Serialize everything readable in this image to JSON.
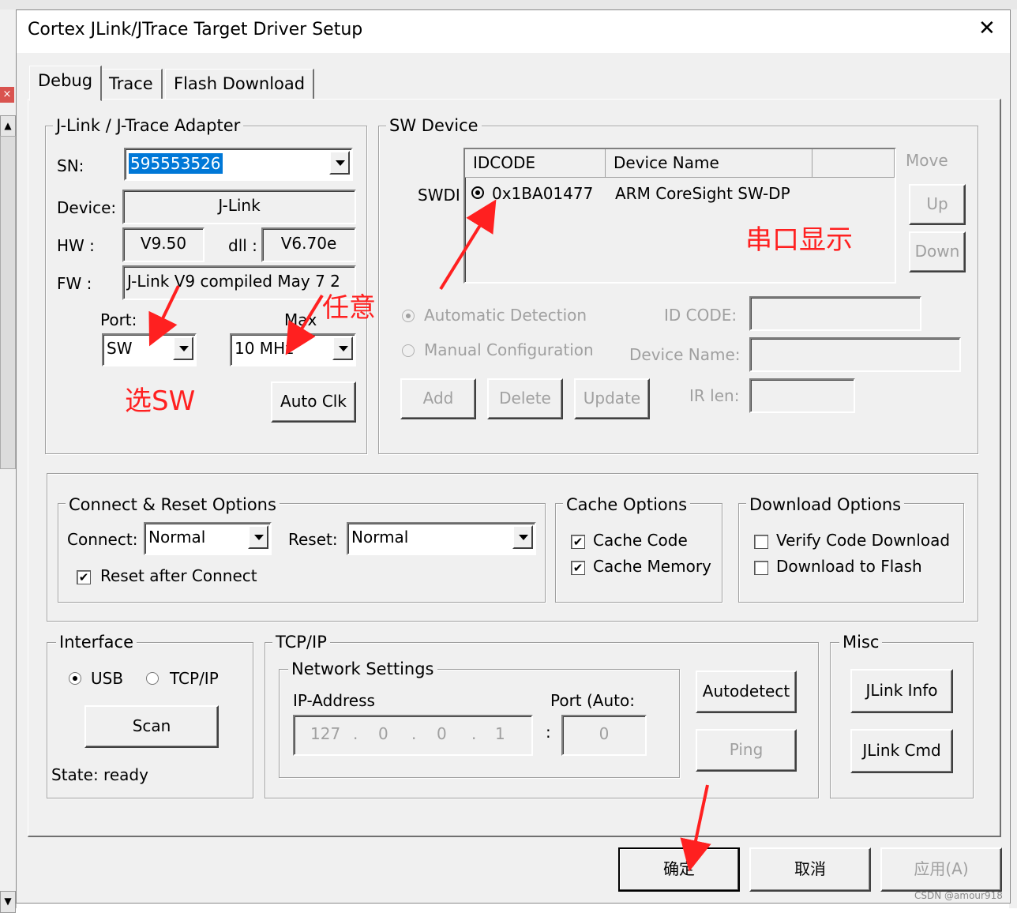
{
  "window": {
    "title": "Cortex JLink/JTrace Target Driver Setup"
  },
  "tabs": [
    {
      "label": "Debug"
    },
    {
      "label": "Trace"
    },
    {
      "label": "Flash Download"
    }
  ],
  "adapter": {
    "group_label": "J-Link / J-Trace Adapter",
    "sn_label": "SN:",
    "sn_value": "595553526",
    "device_label": "Device:",
    "device_value": "J-Link",
    "hw_label": "HW :",
    "hw_value": "V9.50",
    "dll_label": "dll :",
    "dll_value": "V6.70e",
    "fw_label": "FW :",
    "fw_value": "J-Link V9 compiled May  7 2",
    "port_label": "Port:",
    "port_value": "SW",
    "max_label": "Max",
    "max_value": "10 MHz",
    "autoclk_label": "Auto Clk"
  },
  "sw_device": {
    "group_label": "SW Device",
    "row_label": "SWDI",
    "columns": [
      "IDCODE",
      "Device Name"
    ],
    "rows": [
      {
        "idcode": "0x1BA01477",
        "name": "ARM CoreSight SW-DP"
      }
    ],
    "move_label": "Move",
    "up_label": "Up",
    "down_label": "Down",
    "auto_label": "Automatic Detection",
    "manual_label": "Manual Configuration",
    "idcode_label": "ID CODE:",
    "devname_label": "Device Name:",
    "irlen_label": "IR len:",
    "add_label": "Add",
    "delete_label": "Delete",
    "update_label": "Update"
  },
  "connect_reset": {
    "group_label": "Connect & Reset Options",
    "connect_label": "Connect:",
    "connect_value": "Normal",
    "reset_label": "Reset:",
    "reset_value": "Normal",
    "reset_after_label": "Reset after Connect"
  },
  "cache": {
    "group_label": "Cache Options",
    "code_label": "Cache Code",
    "memory_label": "Cache Memory"
  },
  "download": {
    "group_label": "Download Options",
    "verify_label": "Verify Code Download",
    "flash_label": "Download to Flash"
  },
  "interface": {
    "group_label": "Interface",
    "usb_label": "USB",
    "tcpip_label": "TCP/IP",
    "scan_label": "Scan",
    "state_text": "State: ready"
  },
  "tcpip": {
    "group_label": "TCP/IP",
    "net_label": "Network Settings",
    "ip_label": "IP-Address",
    "port_label": "Port (Auto:",
    "ip_parts": [
      "127",
      "0",
      "0",
      "1"
    ],
    "port_value": "0",
    "colon": ":",
    "autodetect_label": "Autodetect",
    "ping_label": "Ping"
  },
  "misc": {
    "group_label": "Misc",
    "info_label": "JLink Info",
    "cmd_label": "JLink Cmd"
  },
  "footer": {
    "ok_label": "确定",
    "cancel_label": "取消",
    "apply_label": "应用(A)"
  },
  "annotations": {
    "serial": "串口显示",
    "any": "任意",
    "choose_sw": "选SW"
  },
  "watermark": "CSDN @amour918"
}
